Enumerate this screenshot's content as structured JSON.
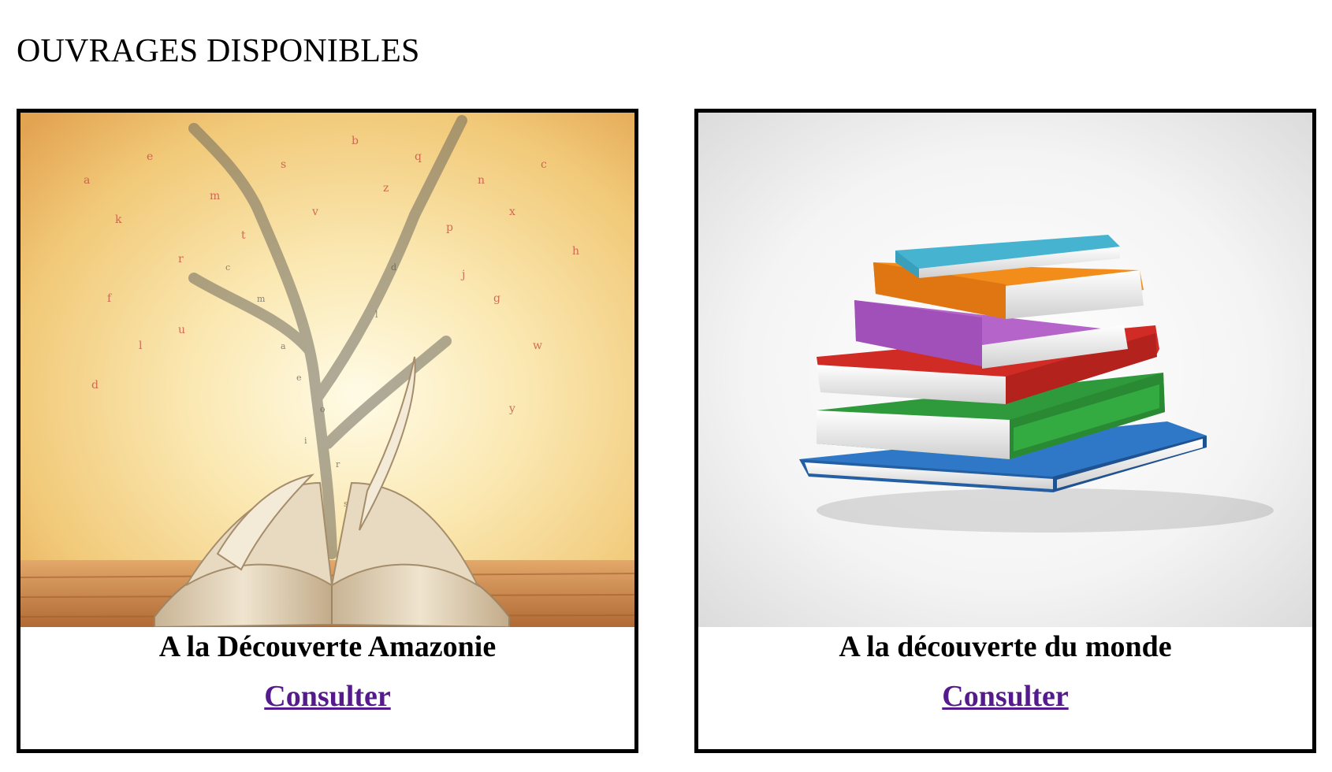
{
  "page": {
    "title": "OUVRAGES DISPONIBLES"
  },
  "books": [
    {
      "title": "A la Découverte Amazonie",
      "link_label": "Consulter",
      "image": "open-book-letter-tree-illustration"
    },
    {
      "title": "A la découverte du monde",
      "link_label": "Consulter",
      "image": "stack-of-colorful-books-illustration"
    }
  ],
  "colors": {
    "link": "#551a8b",
    "border": "#000000"
  }
}
